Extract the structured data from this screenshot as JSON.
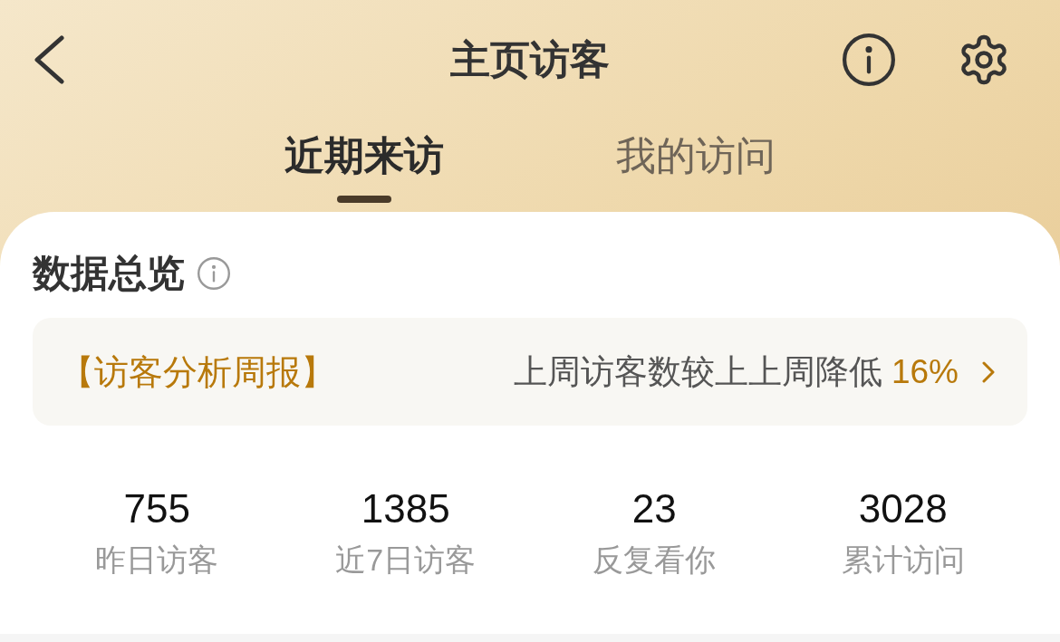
{
  "header": {
    "title": "主页访客"
  },
  "tabs": [
    {
      "label": "近期来访",
      "selected": true
    },
    {
      "label": "我的访问",
      "selected": false
    }
  ],
  "overview": {
    "title": "数据总览",
    "report": {
      "label": "【访客分析周报】",
      "summary": "上周访客数较上上周降低",
      "change": "16%"
    }
  },
  "stats": [
    {
      "value": "755",
      "label": "昨日访客"
    },
    {
      "value": "1385",
      "label": "近7日访客"
    },
    {
      "value": "23",
      "label": "反复看你"
    },
    {
      "value": "3028",
      "label": "累计访问"
    }
  ]
}
